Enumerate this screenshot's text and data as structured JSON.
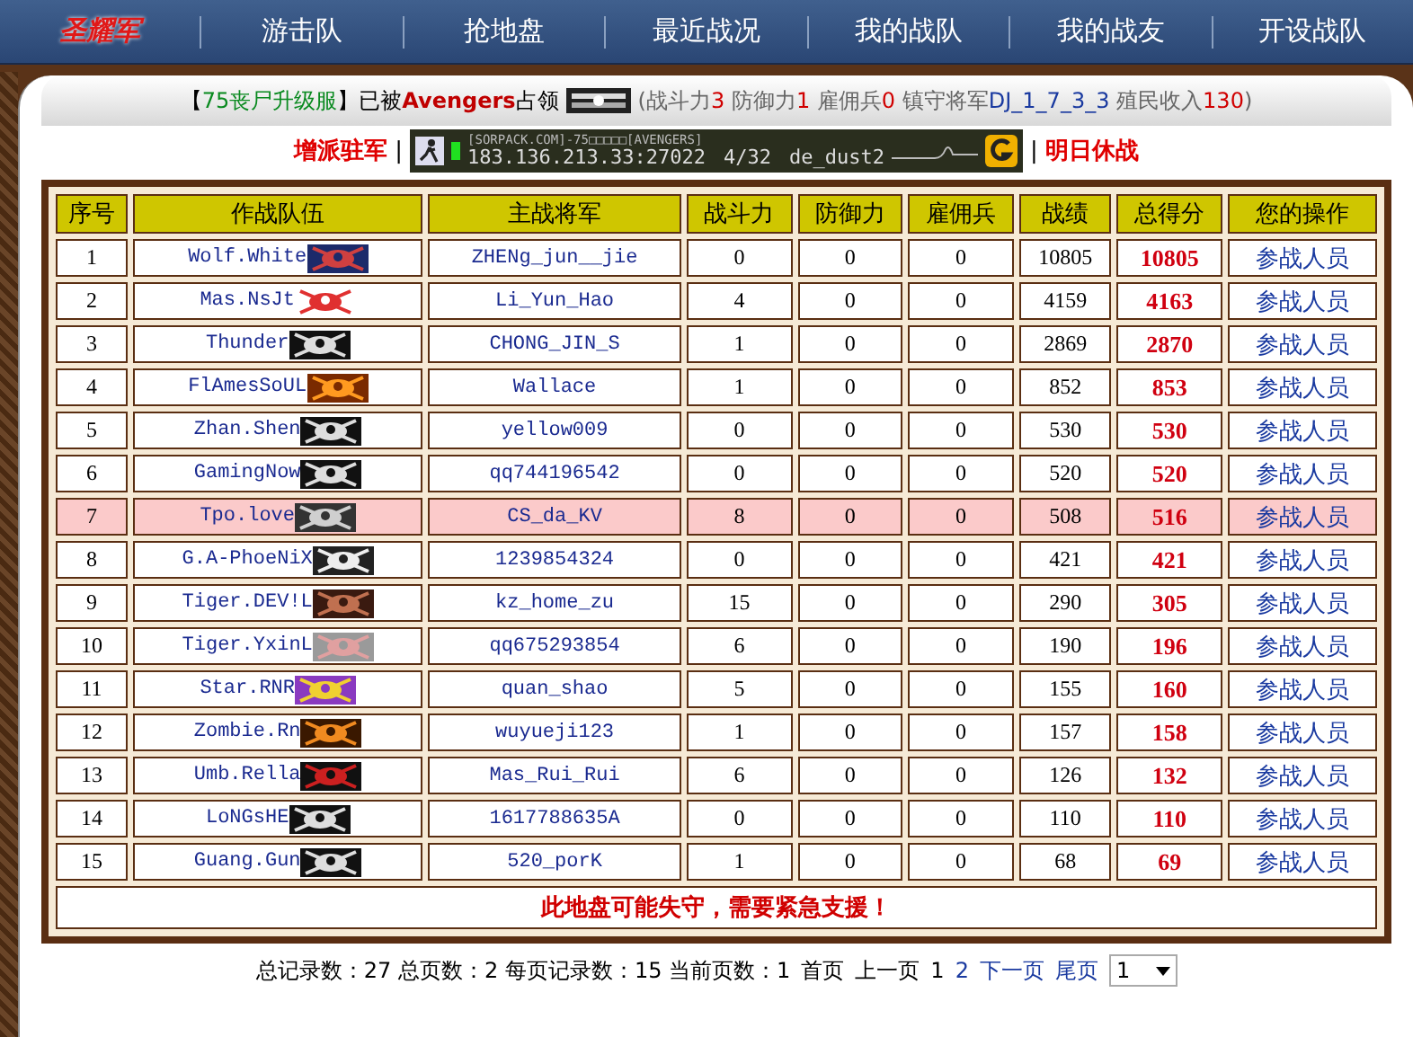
{
  "nav": [
    {
      "label": "圣耀军",
      "selected": true
    },
    {
      "label": "游击队",
      "selected": false
    },
    {
      "label": "抢地盘",
      "selected": false
    },
    {
      "label": "最近战况",
      "selected": false
    },
    {
      "label": "我的战队",
      "selected": false
    },
    {
      "label": "我的战友",
      "selected": false
    },
    {
      "label": "开设战队",
      "selected": false
    }
  ],
  "status_line": [
    {
      "text": "【",
      "color": "#000000"
    },
    {
      "text": "75丧尸升级服",
      "color": "#0a8a20"
    },
    {
      "text": "】已被",
      "color": "#000000"
    },
    {
      "text": "**Avengers**",
      "color": "#c00000"
    },
    {
      "text": "占领",
      "color": "#000000"
    }
  ],
  "status_stats": [
    {
      "text": "(战斗力",
      "color": "#666666"
    },
    {
      "text": "3",
      "color": "#d00000"
    },
    {
      "text": " 防御力",
      "color": "#666666"
    },
    {
      "text": "1",
      "color": "#d00000"
    },
    {
      "text": " 雇佣兵",
      "color": "#666666"
    },
    {
      "text": "0",
      "color": "#d00000"
    },
    {
      "text": " 镇守将军",
      "color": "#666666"
    },
    {
      "text": "DJ_1_7_3_3",
      "color": "#1a3aa0"
    },
    {
      "text": " 殖民收入",
      "color": "#666666"
    },
    {
      "text": "130",
      "color": "#d00000"
    },
    {
      "text": ")",
      "color": "#666666"
    }
  ],
  "actions": {
    "left": "增派驻军",
    "right": "明日休战",
    "separator": "|"
  },
  "server": {
    "name": "[SORPACK.COM]-75□□□□□[AVENGERS]",
    "address": "183.136.213.33:27022",
    "players": "4/32",
    "map": "de_dust2"
  },
  "table": {
    "columns": [
      "序号",
      "作战队伍",
      "主战将军",
      "战斗力",
      "防御力",
      "雇佣兵",
      "战绩",
      "总得分",
      "您的操作"
    ],
    "rows": [
      {
        "no": "1",
        "team": "Wolf.White",
        "general": "ZHENg_jun__jie",
        "attack": "0",
        "defense": "0",
        "mercs": "0",
        "record": "10805",
        "score": "10805",
        "action": "参战人员",
        "selected": false
      },
      {
        "no": "2",
        "team": "Mas.NsJt",
        "general": "Li_Yun_Hao",
        "attack": "4",
        "defense": "0",
        "mercs": "0",
        "record": "4159",
        "score": "4163",
        "action": "参战人员",
        "selected": false
      },
      {
        "no": "3",
        "team": "Thunder",
        "general": "CHONG_JIN_S",
        "attack": "1",
        "defense": "0",
        "mercs": "0",
        "record": "2869",
        "score": "2870",
        "action": "参战人员",
        "selected": false
      },
      {
        "no": "4",
        "team": "FlAmesSoUL",
        "general": "Wallace",
        "attack": "1",
        "defense": "0",
        "mercs": "0",
        "record": "852",
        "score": "853",
        "action": "参战人员",
        "selected": false
      },
      {
        "no": "5",
        "team": "Zhan.Shen",
        "general": "yellow009",
        "attack": "0",
        "defense": "0",
        "mercs": "0",
        "record": "530",
        "score": "530",
        "action": "参战人员",
        "selected": false
      },
      {
        "no": "6",
        "team": "GamingNow",
        "general": "qq744196542",
        "attack": "0",
        "defense": "0",
        "mercs": "0",
        "record": "520",
        "score": "520",
        "action": "参战人员",
        "selected": false
      },
      {
        "no": "7",
        "team": "Tpo.love",
        "general": "CS_da_KV",
        "attack": "8",
        "defense": "0",
        "mercs": "0",
        "record": "508",
        "score": "516",
        "action": "参战人员",
        "selected": true
      },
      {
        "no": "8",
        "team": "G.A-PhoeNiX",
        "general": "1239854324",
        "attack": "0",
        "defense": "0",
        "mercs": "0",
        "record": "421",
        "score": "421",
        "action": "参战人员",
        "selected": false
      },
      {
        "no": "9",
        "team": "Tiger.DEV!L",
        "general": "kz_home_zu",
        "attack": "15",
        "defense": "0",
        "mercs": "0",
        "record": "290",
        "score": "305",
        "action": "参战人员",
        "selected": false
      },
      {
        "no": "10",
        "team": "Tiger.YxinL",
        "general": "qq675293854",
        "attack": "6",
        "defense": "0",
        "mercs": "0",
        "record": "190",
        "score": "196",
        "action": "参战人员",
        "selected": false
      },
      {
        "no": "11",
        "team": "Star.RNR",
        "general": "quan_shao",
        "attack": "5",
        "defense": "0",
        "mercs": "0",
        "record": "155",
        "score": "160",
        "action": "参战人员",
        "selected": false
      },
      {
        "no": "12",
        "team": "Zombie.Rn",
        "general": "wuyueji123",
        "attack": "1",
        "defense": "0",
        "mercs": "0",
        "record": "157",
        "score": "158",
        "action": "参战人员",
        "selected": false
      },
      {
        "no": "13",
        "team": "Umb.Rella",
        "general": "Mas_Rui_Rui",
        "attack": "6",
        "defense": "0",
        "mercs": "0",
        "record": "126",
        "score": "132",
        "action": "参战人员",
        "selected": false
      },
      {
        "no": "14",
        "team": "LoNGsHE",
        "general": "1617788635A",
        "attack": "0",
        "defense": "0",
        "mercs": "0",
        "record": "110",
        "score": "110",
        "action": "参战人员",
        "selected": false
      },
      {
        "no": "15",
        "team": "Guang.Gun",
        "general": "520_porK",
        "attack": "1",
        "defense": "0",
        "mercs": "0",
        "record": "68",
        "score": "69",
        "action": "参战人员",
        "selected": false
      }
    ],
    "warning": "此地盘可能失守，需要紧急支援！"
  },
  "pagination": {
    "summary": "总记录数：27 总页数：2 每页记录数：15 当前页数：1",
    "links": [
      {
        "label": "首页",
        "disabled": true
      },
      {
        "label": "上一页",
        "disabled": true
      },
      {
        "label": "1",
        "disabled": true
      },
      {
        "label": "2",
        "disabled": false
      },
      {
        "label": "下一页",
        "disabled": false
      },
      {
        "label": "尾页",
        "disabled": false
      }
    ],
    "page_select": "1"
  }
}
